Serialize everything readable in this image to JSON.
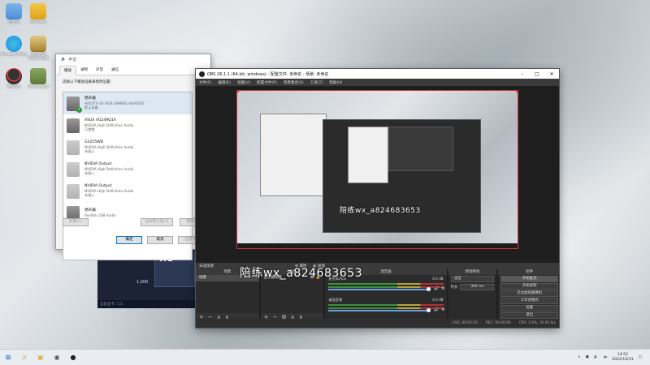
{
  "desktop": {
    "icons": [
      {
        "label": "回收站",
        "color": "#4a90d9"
      },
      {
        "label": "WeGame",
        "color": "#e0a31a"
      },
      {
        "label": "Microsoft Edge",
        "color": "#1f8de0"
      },
      {
        "label": "英雄联盟WeGame版",
        "color": "#caa24a"
      },
      {
        "label": "腾讯QQ",
        "color": "#1c1c1c"
      },
      {
        "label": "WeGame版",
        "color": "#5c7a3a"
      }
    ]
  },
  "sound_dialog": {
    "title": "声音",
    "tabs": [
      "播放",
      "录制",
      "声音",
      "通信"
    ],
    "instruction": "选择以下播放设备来修改设置:",
    "devices": [
      {
        "name": "扬声器",
        "sub1": "HS50TS GA RGB GAMING HEADSET",
        "sub2": "默认设备",
        "selected": true
      },
      {
        "name": "ASUS VG249Q1A",
        "sub1": "NVIDIA High Definition Audio",
        "sub2": "已就绪",
        "selected": false
      },
      {
        "name": "G3255WD",
        "sub1": "NVIDIA High Definition Audio",
        "sub2": "未插入",
        "selected": false
      },
      {
        "name": "NVIDIA Output",
        "sub1": "NVIDIA High Definition Audio",
        "sub2": "未插入",
        "selected": false
      },
      {
        "name": "NVIDIA Output",
        "sub1": "NVIDIA High Definition Audio",
        "sub2": "未插入",
        "selected": false
      },
      {
        "name": "扬声器",
        "sub1": "Realtek USB Audio",
        "sub2": "",
        "selected": false
      }
    ],
    "configure_label": "配置(C)",
    "set_default_label": "设为默认值(S)",
    "properties_label": "属性(P)",
    "ok_label": "确定",
    "cancel_label": "取消",
    "apply_label": "应用(A)"
  },
  "behind_window": {
    "heading": "WE",
    "value": "1,000",
    "status": "当前显卡: 1.1"
  },
  "obs": {
    "title": "OBS 26.1.1 (64-bit, windows) - 配置文件: 未命名 - 场景: 未命名",
    "menu": [
      "文件(F)",
      "编辑(E)",
      "视图(V)",
      "配置文件(P)",
      "场景集合(S)",
      "工具(T)",
      "帮助(H)"
    ],
    "no_source_label": "未选择源",
    "properties_label": "属性",
    "filters_label": "滤镜",
    "docks": {
      "scenes": {
        "title": "场景",
        "items": [
          "场景"
        ]
      },
      "sources": {
        "title": "来源",
        "items": [
          "显示器采集"
        ]
      },
      "mixer": {
        "title": "混音器",
        "channels": [
          {
            "name": "桌面音频",
            "db": "0.0 dB"
          },
          {
            "name": "麦克风/Aux",
            "db": "0.0 dB"
          }
        ]
      },
      "transitions": {
        "title": "转场特效",
        "type": "淡出",
        "duration_label": "时长",
        "duration": "300 ms"
      },
      "controls": {
        "title": "控件",
        "buttons": [
          "开始推流",
          "开始录制",
          "启动虚拟摄像机",
          "工作室模式",
          "设置",
          "退出"
        ]
      }
    },
    "status": {
      "live": "LIVE: 00:00:00",
      "rec": "REC: 00:00:00",
      "cpu": "CPU: 1.9%, 30.00 fps"
    }
  },
  "watermark": {
    "text": "陪练wx_a824683653"
  },
  "taskbar": {
    "time": "14:52",
    "date": "2022/10/31",
    "input_method": "中"
  }
}
